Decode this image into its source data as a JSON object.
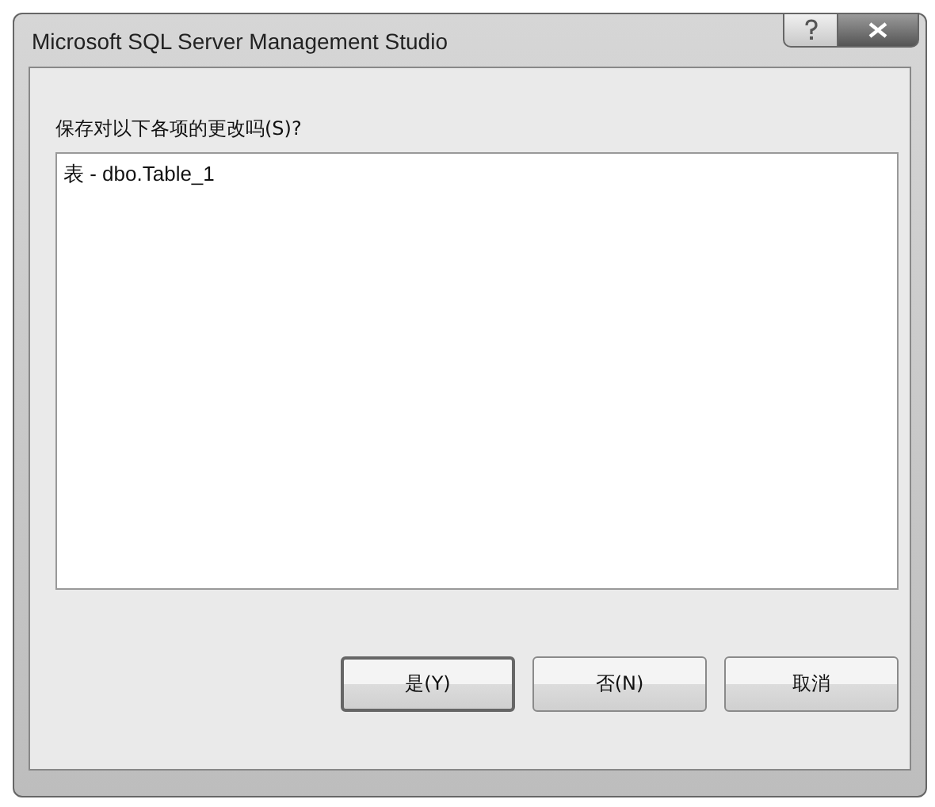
{
  "window": {
    "title": "Microsoft SQL Server Management Studio"
  },
  "prompt": "保存对以下各项的更改吗(S)?",
  "items": [
    "表 - dbo.Table_1"
  ],
  "buttons": [
    {
      "label": "是(Y)",
      "default": true
    },
    {
      "label": "否(N)",
      "default": false
    },
    {
      "label": "取消",
      "default": false
    }
  ]
}
